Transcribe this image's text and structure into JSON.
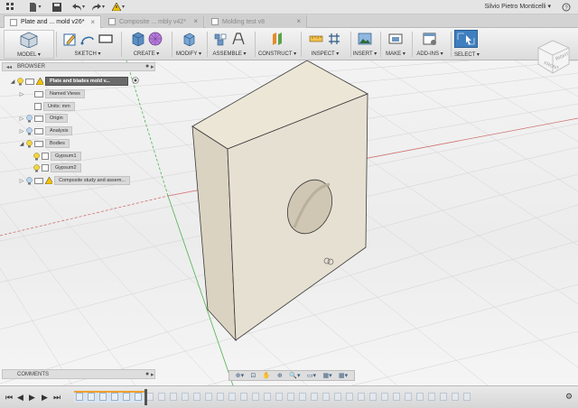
{
  "topbar": {
    "user_name": "Silvio Pietro Monticelli",
    "user_caret": "▾",
    "icons": [
      "app-grid-icon",
      "file-icon",
      "save-icon",
      "undo-icon",
      "redo-icon",
      "warning-icon"
    ]
  },
  "tabs": [
    {
      "label": "Plate and ... mold v26*",
      "active": true,
      "close": "×"
    },
    {
      "label": "Composite ... mbly v42*",
      "active": false,
      "close": "×"
    },
    {
      "label": "Molding test v8",
      "active": false,
      "close": "×"
    }
  ],
  "ribbon": {
    "workspace": "MODEL ▾",
    "groups": [
      {
        "label": "SKETCH ▾"
      },
      {
        "label": "CREATE ▾"
      },
      {
        "label": "MODIFY ▾"
      },
      {
        "label": "ASSEMBLE ▾"
      },
      {
        "label": "CONSTRUCT ▾"
      },
      {
        "label": "INSPECT ▾"
      },
      {
        "label": "INSERT ▾"
      },
      {
        "label": "MAKE ▾"
      },
      {
        "label": "ADD-INS ▾"
      },
      {
        "label": "SELECT ▾"
      }
    ]
  },
  "browser": {
    "title": "BROWSER",
    "collapse": "◂◂",
    "dot": "●",
    "more": "▸",
    "root": "Plate and blades mold v...",
    "items": [
      {
        "label": "Named Views"
      },
      {
        "label": "Units: mm"
      },
      {
        "label": "Origin"
      },
      {
        "label": "Analysis"
      },
      {
        "label": "Bodies"
      },
      {
        "label": "Gypsum1"
      },
      {
        "label": "Gypsum2"
      },
      {
        "label": "Composite study and assem..."
      }
    ],
    "tri_closed": "▷",
    "tri_open": "◢"
  },
  "comments": {
    "title": "COMMENTS",
    "dot": "●",
    "more": "▸"
  },
  "viewcube": {
    "label": "FRONT",
    "right_label": "RIGHT"
  },
  "navbar": {
    "items": [
      "⊕▾",
      "⊡",
      "✋",
      "⊕",
      "🔍▾",
      "▭▾",
      "▦▾",
      "▦▾"
    ]
  },
  "timeline": {
    "controls": [
      "⏮",
      "◀",
      "▶",
      "▶",
      "⏭"
    ],
    "settings": "⚙"
  },
  "colors": {
    "accent": "#3f7fbf",
    "body": "#e6e0d2",
    "edge": "#3a3a3a"
  }
}
